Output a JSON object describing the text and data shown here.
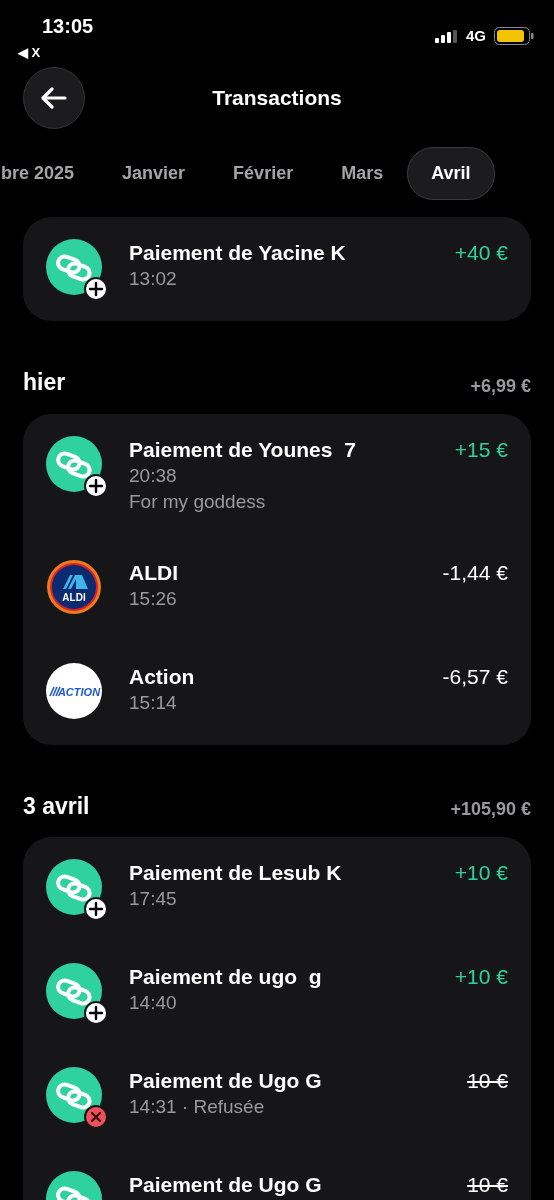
{
  "status_bar": {
    "time": "13:05",
    "back_app": "◀ X",
    "network": "4G"
  },
  "header": {
    "title": "Transactions"
  },
  "months": [
    {
      "label": "bre 2025",
      "selected": false
    },
    {
      "label": "Janvier",
      "selected": false
    },
    {
      "label": "Février",
      "selected": false
    },
    {
      "label": "Mars",
      "selected": false
    },
    {
      "label": "Avril",
      "selected": true
    }
  ],
  "groups": [
    {
      "transactions": [
        {
          "kind": "link",
          "name": "Paiement de Yacine K",
          "time": "13:02",
          "amount": "+40 €",
          "credit": true,
          "declined": false
        }
      ]
    },
    {
      "title": "hier",
      "total": "+6,99 €",
      "transactions": [
        {
          "kind": "link",
          "name": "Paiement de Younes  7",
          "time": "20:38",
          "note": "For my goddess",
          "amount": "+15 €",
          "credit": true,
          "declined": false
        },
        {
          "kind": "aldi",
          "logo_text": "ALDI",
          "name": "ALDI",
          "time": "15:26",
          "amount": "-1,44 €",
          "credit": false,
          "declined": false
        },
        {
          "kind": "action",
          "logo_text": "ACTION",
          "name": "Action",
          "time": "15:14",
          "amount": "-6,57 €",
          "credit": false,
          "declined": false
        }
      ]
    },
    {
      "title": "3 avril",
      "total": "+105,90 €",
      "transactions": [
        {
          "kind": "link",
          "name": "Paiement de Lesub K",
          "time": "17:45",
          "amount": "+10 €",
          "credit": true,
          "declined": false
        },
        {
          "kind": "link",
          "name": "Paiement de ugo  g",
          "time": "14:40",
          "amount": "+10 €",
          "credit": true,
          "declined": false
        },
        {
          "kind": "link",
          "name": "Paiement de Ugo G",
          "time": "14:31 · Refusée",
          "amount": "10 €",
          "credit": false,
          "declined": true
        },
        {
          "kind": "link",
          "name": "Paiement de Ugo G",
          "amount": "10 €",
          "credit": false,
          "declined": true
        }
      ]
    }
  ]
}
